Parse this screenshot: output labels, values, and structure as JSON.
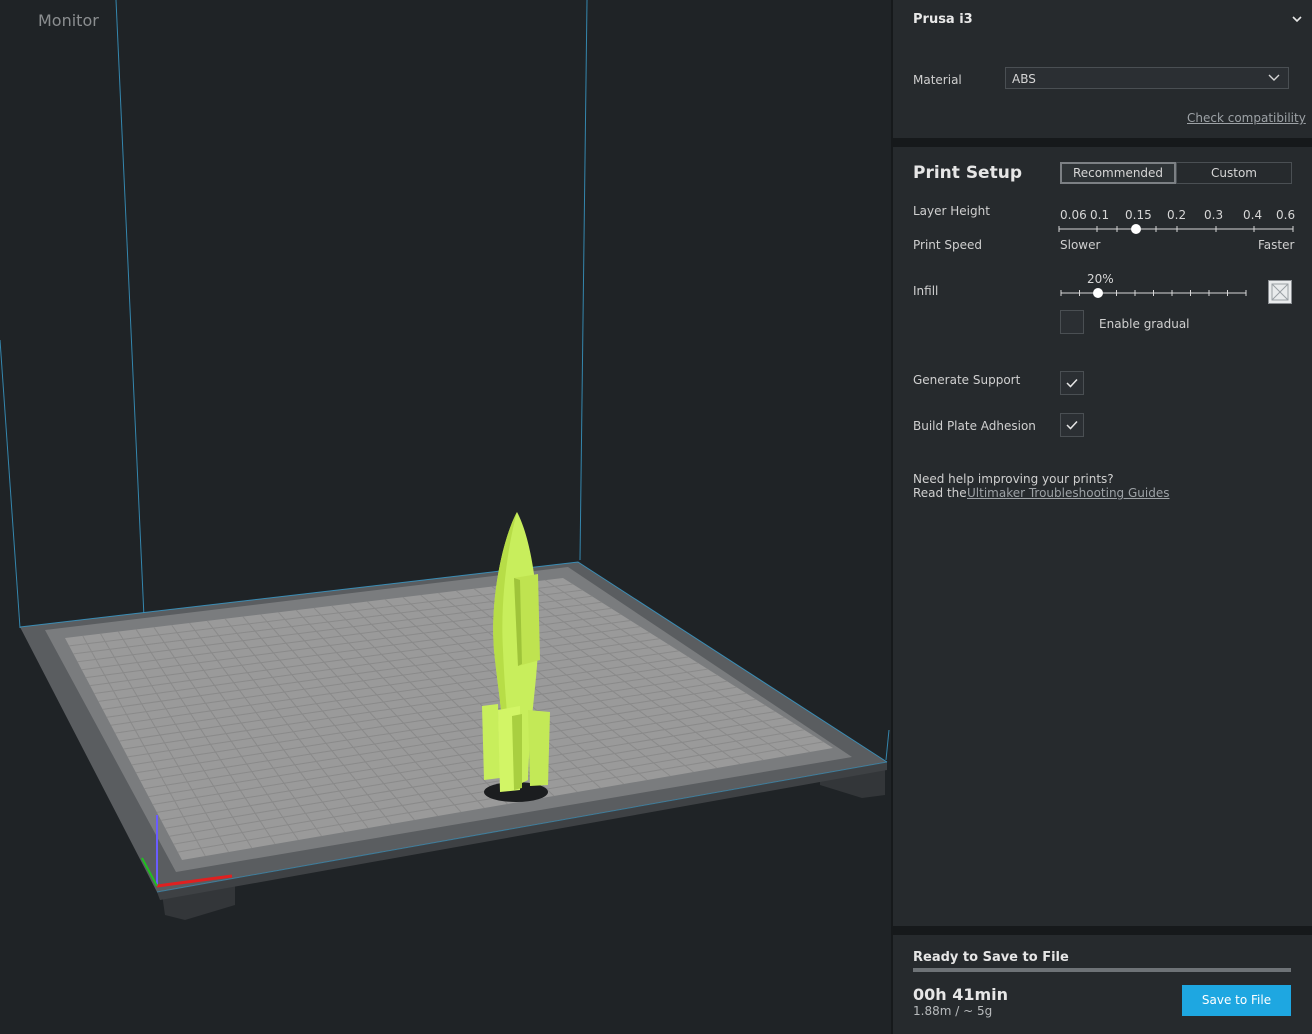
{
  "viewport": {
    "monitor_tab": "Monitor"
  },
  "printer": {
    "name": "Prusa i3",
    "material_label": "Material",
    "material_value": "ABS",
    "check_compat": "Check compatibility"
  },
  "setup": {
    "title": "Print Setup",
    "mode_recommended": "Recommended",
    "mode_custom": "Custom",
    "layer_height_label": "Layer Height",
    "layer_height_ticks": [
      "0.06",
      "0.1",
      "0.15",
      "0.2",
      "0.3",
      "0.4",
      "0.6"
    ],
    "layer_height_selected": "0.15",
    "print_speed_label": "Print Speed",
    "speed_slower": "Slower",
    "speed_faster": "Faster",
    "infill_label": "Infill",
    "infill_value": "20%",
    "infill_fraction": 0.2,
    "enable_gradual_label": "Enable gradual",
    "enable_gradual_checked": false,
    "generate_support_label": "Generate Support",
    "generate_support_checked": true,
    "adhesion_label": "Build Plate Adhesion",
    "adhesion_checked": true,
    "help_line1": "Need help improving your prints?",
    "help_line2_prefix": "Read the",
    "help_link": "Ultimaker Troubleshooting Guides"
  },
  "output": {
    "status": "Ready to Save to File",
    "progress": 1.0,
    "time": "00h 41min",
    "usage": "1.88m / ~ 5g",
    "save_button": "Save to File"
  },
  "colors": {
    "accent": "#1ea7e1",
    "model": "#c8ee5c",
    "bed": "#9a9a9a"
  }
}
